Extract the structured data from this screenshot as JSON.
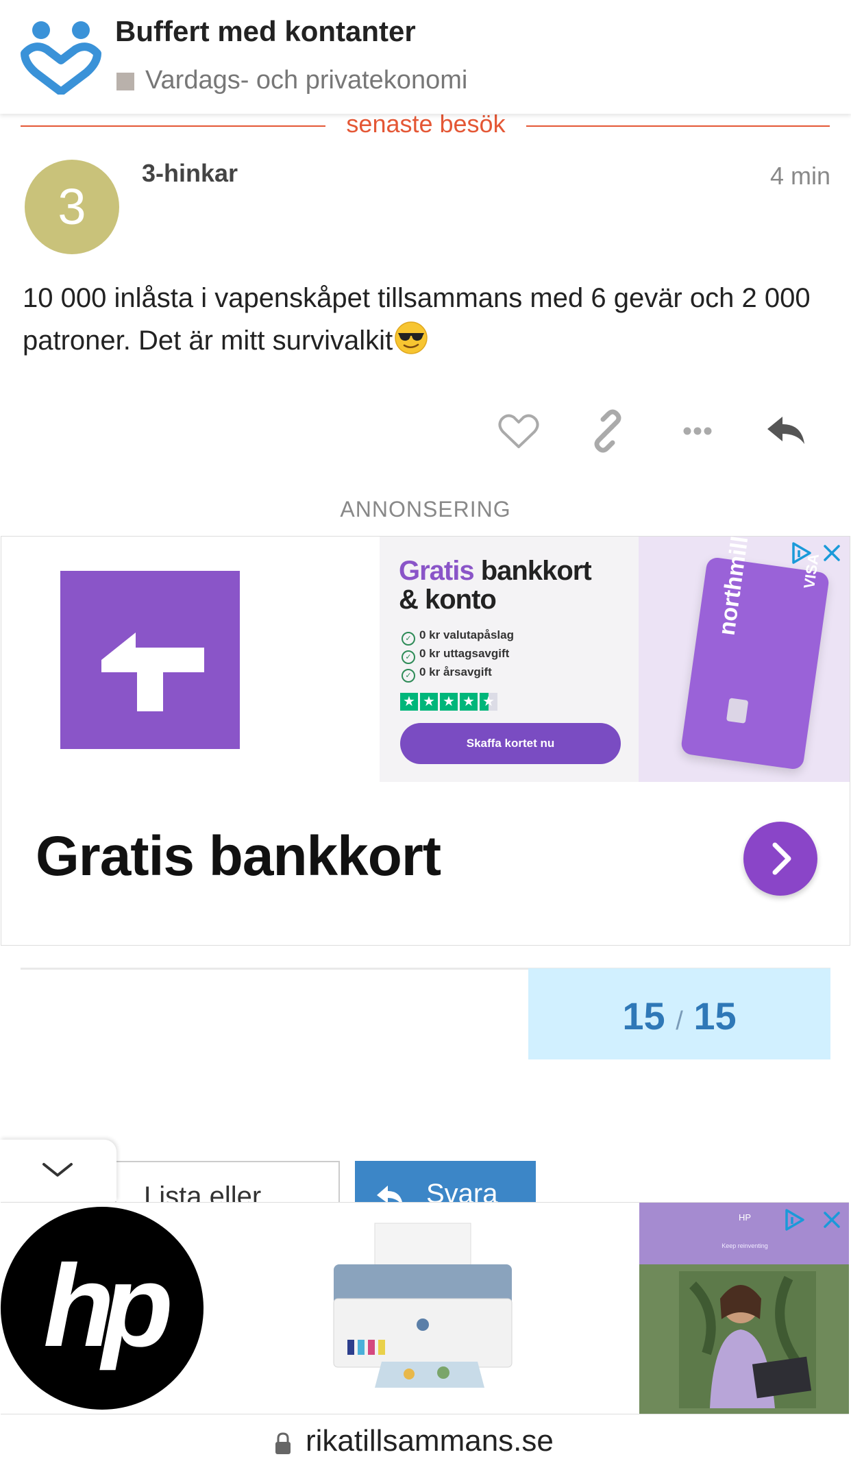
{
  "header": {
    "topic_title": "Buffert med kontanter",
    "category": "Vardags- och privatekonomi",
    "category_color": "#b9b1ab",
    "logo_icon": "people-heart-logo-icon"
  },
  "last_visit_label": "senaste besök",
  "post": {
    "avatar_letter": "3",
    "avatar_color": "#c9c27a",
    "username": "3-hinkar",
    "time": "4 min",
    "body": "10 000 inlåsta i vapenskåpet tillsammans med 6 gevär och 2 000 patroner. Det är mitt survivalkit",
    "emoji": "smiling-face-with-sunglasses",
    "actions": [
      "heart-icon",
      "link-icon",
      "more-icon",
      "reply-icon"
    ]
  },
  "ad_label": "ANNONSERING",
  "ad1": {
    "headline_purple": "Gratis",
    "headline_rest": " bankkort",
    "headline_line2": "& konto",
    "features": [
      "0 kr valutapåslag",
      "0 kr uttagsavgift",
      "0 kr årsavgift"
    ],
    "rating_stars": 4.5,
    "cta": "Skaffa kortet nu",
    "card_brand": "northmill bank",
    "card_network": "VISA",
    "title": "Gratis bankkort",
    "brand_color": "#8a55c8"
  },
  "timeline": {
    "current": "15",
    "separator": "/",
    "total": "15"
  },
  "bottom_buttons": {
    "bookmark_label": "Lista eller",
    "reply_label": "Svara"
  },
  "ad2": {
    "logo_text": "hp",
    "brand": "HP",
    "brand_sub": "Keep reinventing"
  },
  "url_bar": {
    "domain": "rikatillsammans.se"
  }
}
